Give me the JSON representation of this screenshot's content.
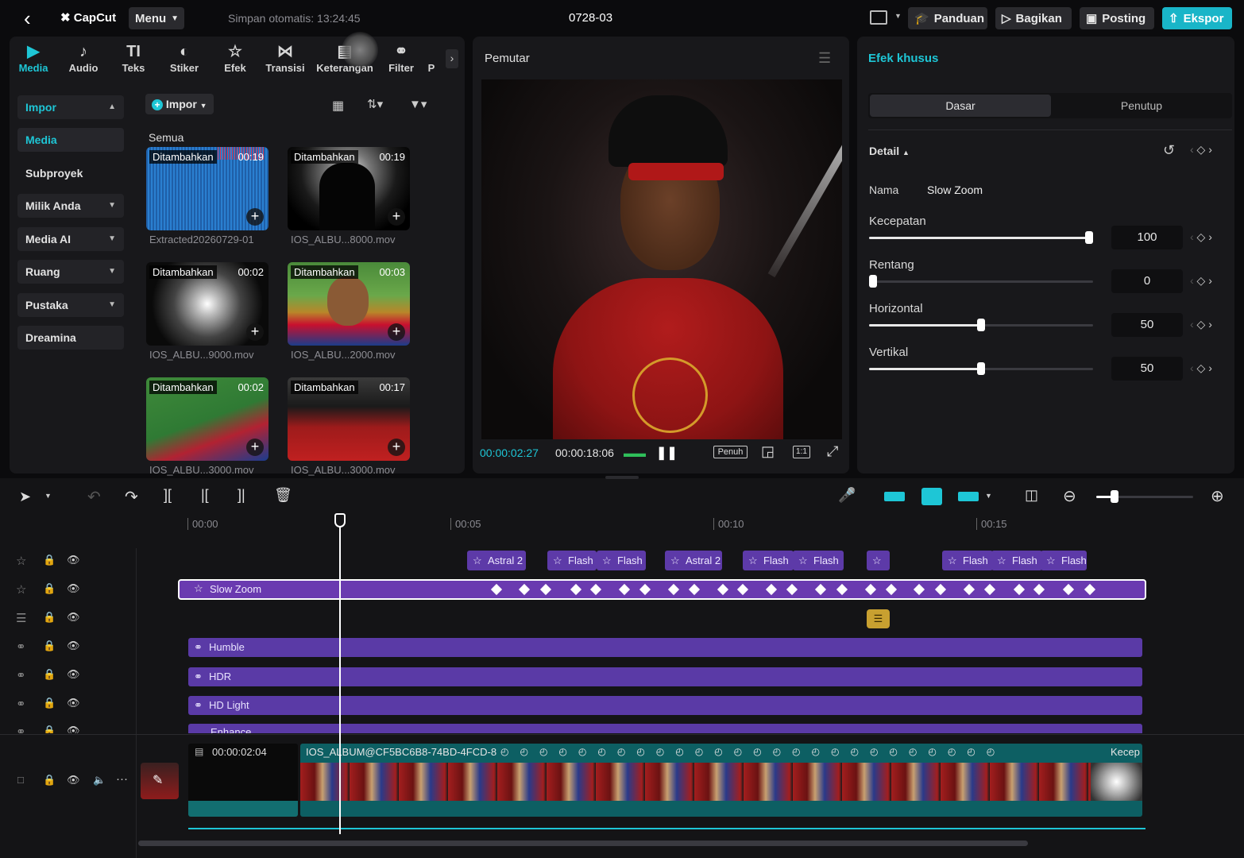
{
  "topbar": {
    "back_icon": "chevron-left-icon",
    "brand": "CapCut",
    "menu_label": "Menu",
    "autosave": "Simpan otomatis: 13:24:45",
    "project_title": "0728-03",
    "guide_label": "Panduan",
    "share_label": "Bagikan",
    "post_label": "Posting",
    "export_label": "Ekspor",
    "accent_color": "#19b5c8"
  },
  "toolbar": {
    "items": [
      {
        "label": "Media",
        "icon": "media-icon"
      },
      {
        "label": "Audio",
        "icon": "audio-icon"
      },
      {
        "label": "Teks",
        "icon": "text-icon"
      },
      {
        "label": "Stiker",
        "icon": "sticker-icon"
      },
      {
        "label": "Efek",
        "icon": "effects-icon"
      },
      {
        "label": "Transisi",
        "icon": "transition-icon"
      },
      {
        "label": "Keterangan",
        "icon": "captions-icon"
      },
      {
        "label": "Filter",
        "icon": "filter-icon"
      },
      {
        "label": "P",
        "icon": "more-icon"
      }
    ]
  },
  "sidebar": {
    "items": [
      {
        "label": "Impor"
      },
      {
        "label": "Media"
      },
      {
        "label": "Subproyek"
      },
      {
        "label": "Milik Anda"
      },
      {
        "label": "Media AI"
      },
      {
        "label": "Ruang"
      },
      {
        "label": "Pustaka"
      },
      {
        "label": "Dreamina"
      }
    ]
  },
  "media": {
    "import_label": "Impor",
    "section_label": "Semua",
    "items": [
      {
        "tag": "Ditambahkan",
        "duration": "00:19",
        "name": "Extracted20260729-01"
      },
      {
        "tag": "Ditambahkan",
        "duration": "00:19",
        "name": "IOS_ALBU...8000.mov"
      },
      {
        "tag": "Ditambahkan",
        "duration": "00:02",
        "name": "IOS_ALBU...9000.mov"
      },
      {
        "tag": "Ditambahkan",
        "duration": "00:03",
        "name": "IOS_ALBU...2000.mov"
      },
      {
        "tag": "Ditambahkan",
        "duration": "00:02",
        "name": "IOS_ALBU...3000.mov"
      },
      {
        "tag": "Ditambahkan",
        "duration": "00:17",
        "name": "IOS_ALBU...3000.mov"
      }
    ]
  },
  "player": {
    "title": "Pemutar",
    "current_time": "00:00:02:27",
    "total_time": "00:00:18:06",
    "full_label": "Penuh",
    "ratio_label": "1:1"
  },
  "effects_panel": {
    "title": "Efek khusus",
    "tabs": [
      "Dasar",
      "Penutup"
    ],
    "detail_label": "Detail",
    "name_label": "Nama",
    "name_value": "Slow Zoom",
    "params": [
      {
        "label": "Kecepatan",
        "value": "100",
        "fraction": 1.0
      },
      {
        "label": "Rentang",
        "value": "0",
        "fraction": 0.0
      },
      {
        "label": "Horizontal",
        "value": "50",
        "fraction": 0.5
      },
      {
        "label": "Vertikal",
        "value": "50",
        "fraction": 0.5
      }
    ]
  },
  "timeline": {
    "ruler": [
      "00:00",
      "00:05",
      "00:10",
      "00:15"
    ],
    "fx_chips": [
      "Astral 2",
      "Flash",
      "Flash",
      "Astral 2",
      "Flash",
      "Flash",
      "",
      "Flash",
      "Flash",
      "Flash"
    ],
    "slow_zoom_label": "Slow Zoom",
    "filter_tracks": [
      "Humble",
      "HDR",
      "HD Light",
      "Enhance"
    ],
    "main_clip_time": "00:00:02:04",
    "main_clip_name": "IOS_ALBUM@CF5BC6B8-74BD-4FCD-8",
    "speed_label": "Kecep"
  }
}
